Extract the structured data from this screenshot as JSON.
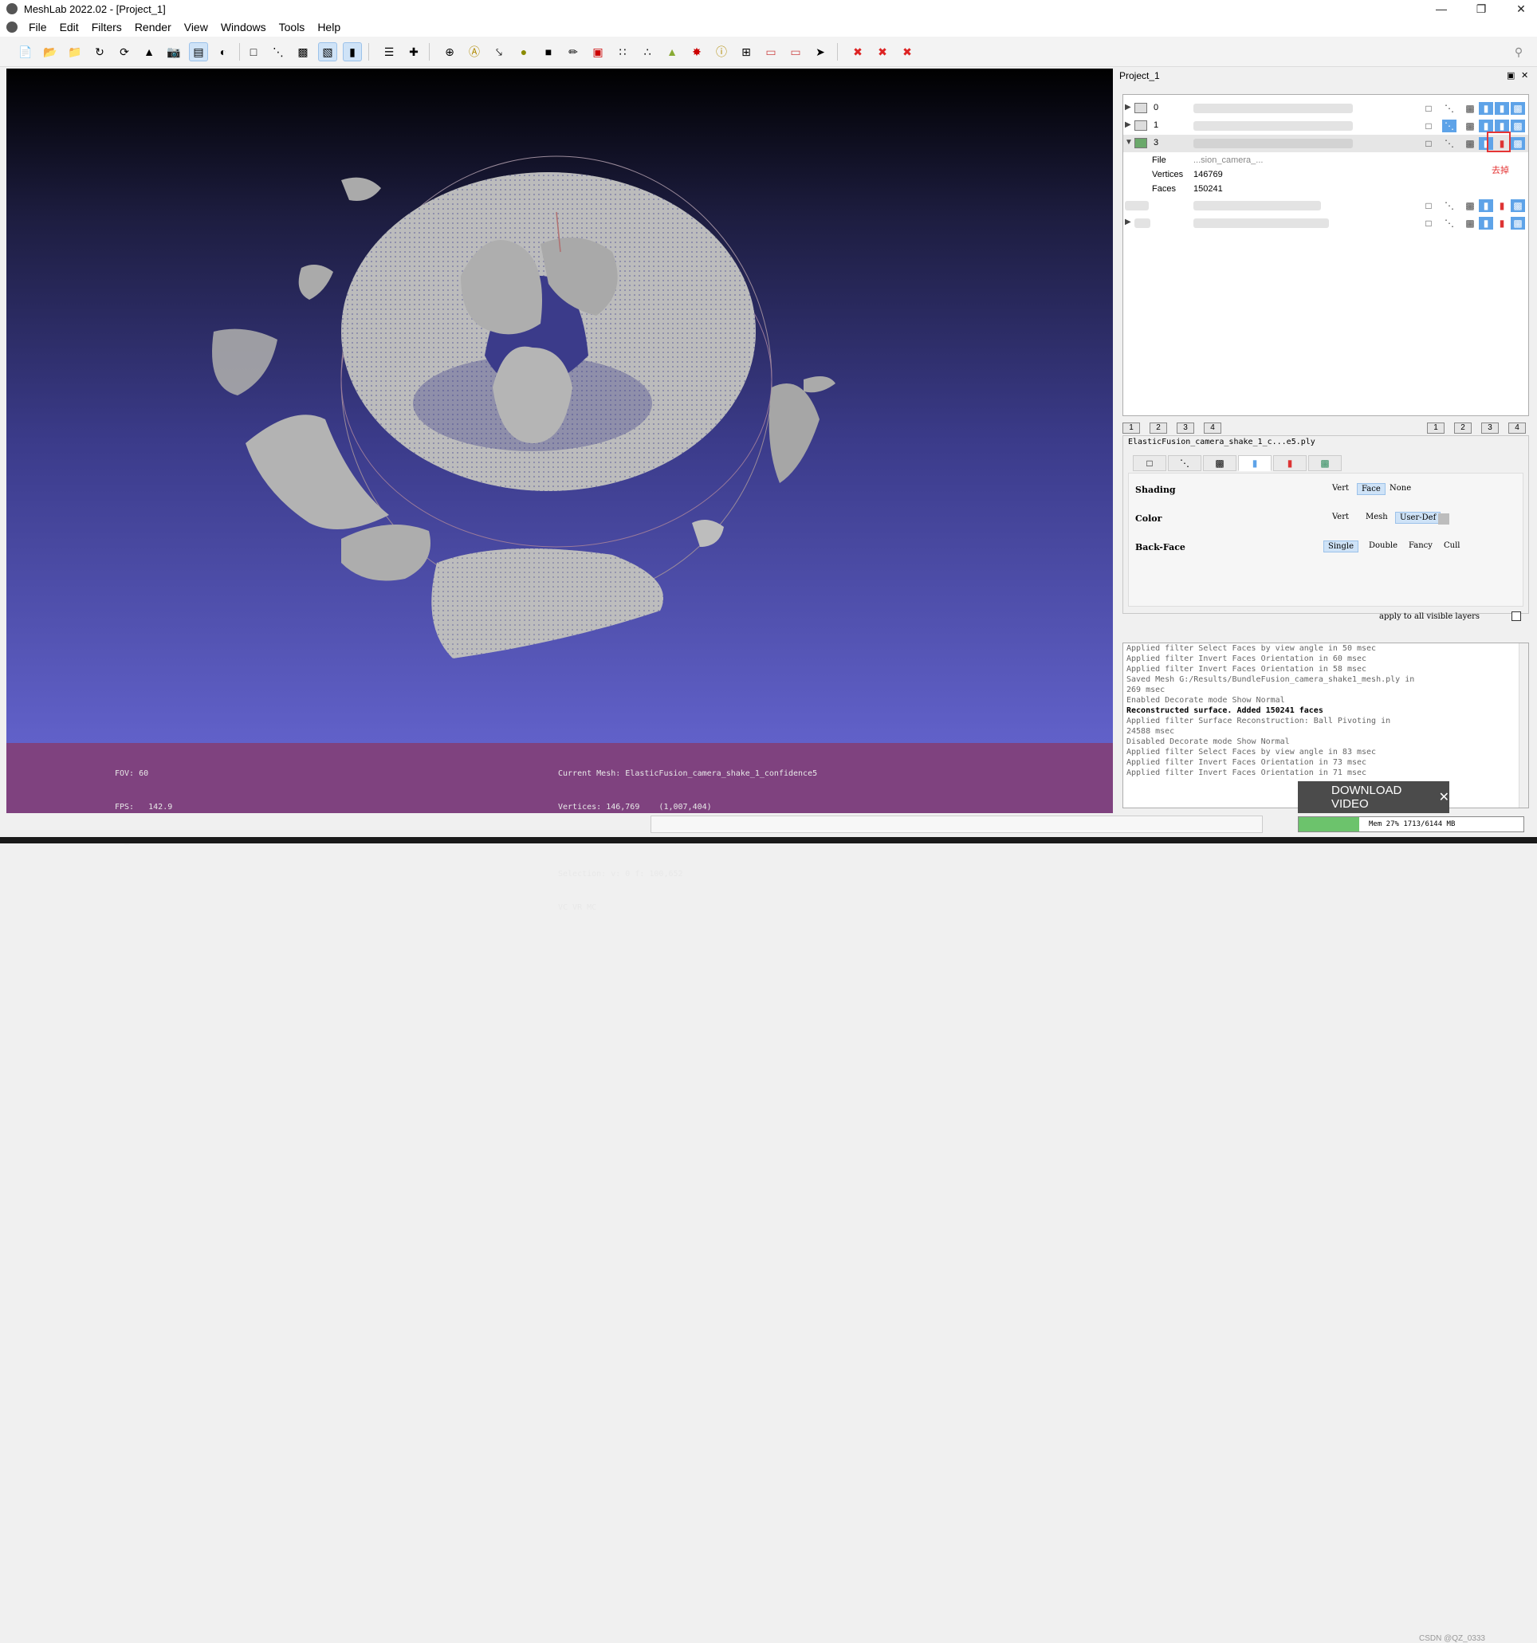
{
  "window": {
    "title": "MeshLab 2022.02 - [Project_1]",
    "minimize_icon": "minimize-icon",
    "restore_icon": "restore-icon",
    "close_icon": "close-icon"
  },
  "menu": {
    "items": [
      "File",
      "Edit",
      "Filters",
      "Render",
      "View",
      "Windows",
      "Tools",
      "Help"
    ]
  },
  "toolbar": {
    "groups": [
      [
        "new-file",
        "open-file",
        "open-project",
        "reload",
        "reload-all",
        "export-mesh",
        "snapshot",
        "layers",
        "render-mode"
      ],
      [
        "bbox",
        "points",
        "wireframe",
        "flat",
        "smooth"
      ],
      [
        "fullscreen",
        "axis"
      ],
      [
        "trackball",
        "annotate",
        "align",
        "paint",
        "measure",
        "draw",
        "select-faces",
        "select-vertices",
        "color-tool",
        "georef",
        "info",
        "pick-points",
        "raster",
        "fit-plane",
        "manipulator"
      ],
      [
        "delete-faces",
        "delete-vertices",
        "delete-both"
      ]
    ]
  },
  "viewport": {
    "info_left": [
      "FOV: 60",
      "FPS:   142.9",
      "BO_RENDERING"
    ],
    "info_right": [
      "Current Mesh: ElasticFusion_camera_shake_1_confidence5",
      "Vertices: 146,769    (1,007,404)",
      "Faces: 150,241    (1,644,794)",
      "Selection: v: 0 f: 100,652",
      "VC VR MC"
    ]
  },
  "panel": {
    "title": "Project_1",
    "layers": [
      {
        "id": "0",
        "expanded": false,
        "selected": false
      },
      {
        "id": "1",
        "expanded": false,
        "selected": false
      },
      {
        "id": "3",
        "expanded": true,
        "selected": true
      }
    ],
    "details": {
      "file_label": "File",
      "file_value": "...sion_camera_...",
      "vertices_label": "Vertices",
      "vertices_value": "146769",
      "faces_label": "Faces",
      "faces_value": "150241"
    },
    "annotation_text": "去掉",
    "numbers_left": [
      "1",
      "2",
      "3",
      "4"
    ],
    "numbers_right": [
      "1",
      "2",
      "3",
      "4"
    ]
  },
  "properties": {
    "file_name": "ElasticFusion_camera_shake_1_c...e5.ply",
    "tabs": [
      "bbox-tab",
      "points-tab",
      "wire-tab",
      "faces-tab",
      "color-tab",
      "texture-tab"
    ],
    "shading": {
      "label": "Shading",
      "options": [
        "Vert",
        "Face",
        "None"
      ],
      "selected": "Face"
    },
    "color": {
      "label": "Color",
      "options": [
        "Vert",
        "Mesh",
        "User-Def"
      ],
      "selected": "User-Def"
    },
    "backface": {
      "label": "Back-Face",
      "options": [
        "Single",
        "Double",
        "Fancy",
        "Cull"
      ],
      "selected": "Single"
    },
    "apply_label": "apply to all visible layers"
  },
  "log": {
    "lines": [
      {
        "text": "Applied filter Select Faces by view angle in 50 msec",
        "bold": false
      },
      {
        "text": "Applied filter Invert Faces Orientation in 60 msec",
        "bold": false
      },
      {
        "text": "Applied filter Invert Faces Orientation in 58 msec",
        "bold": false
      },
      {
        "text": "Saved Mesh G:/Results/BundleFusion_camera_shake1_mesh.ply in",
        "bold": false
      },
      {
        "text": "269 msec",
        "bold": false
      },
      {
        "text": "Enabled Decorate mode Show Normal",
        "bold": false
      },
      {
        "text": "Reconstructed surface. Added 150241 faces",
        "bold": true
      },
      {
        "text": "Applied filter Surface Reconstruction: Ball Pivoting in",
        "bold": false
      },
      {
        "text": "24588 msec",
        "bold": false
      },
      {
        "text": "Disabled Decorate mode Show Normal",
        "bold": false
      },
      {
        "text": "Applied filter Select Faces by view angle in 83 msec",
        "bold": false
      },
      {
        "text": "Applied filter Invert Faces Orientation in 73 msec",
        "bold": false
      },
      {
        "text": "Applied filter Invert Faces Orientation in 71 msec",
        "bold": false
      }
    ]
  },
  "download": {
    "label": "DOWNLOAD VIDEO",
    "close": "✕"
  },
  "status": {
    "memory": "Mem 27% 1713/6144 MB",
    "memory_fraction": 0.27,
    "watermark": "CSDN @QZ_0333"
  }
}
